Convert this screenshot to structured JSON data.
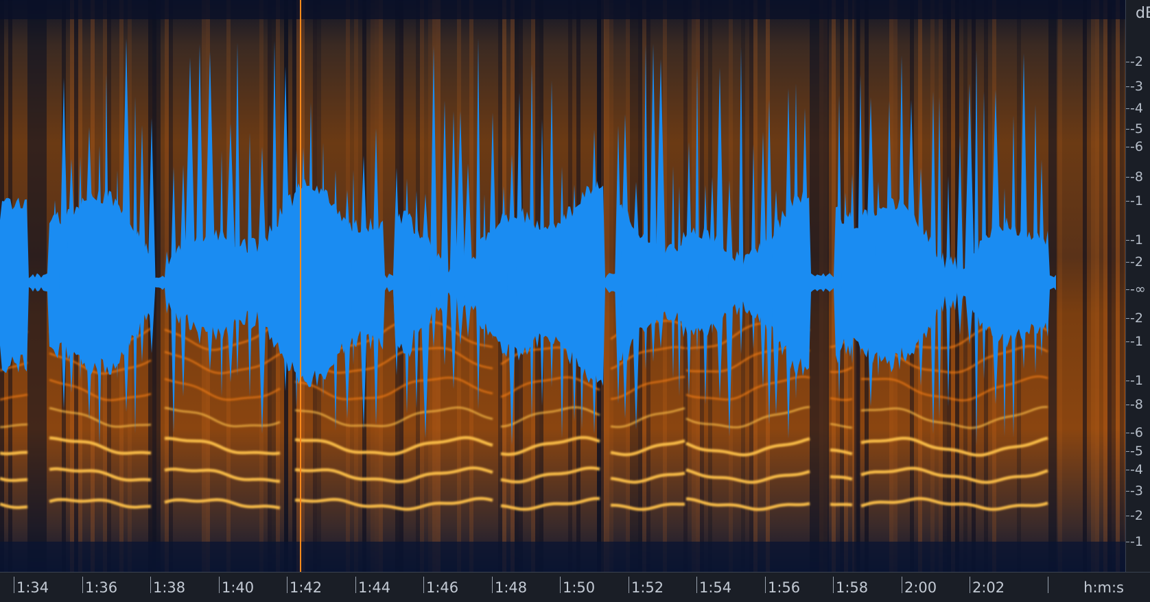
{
  "view": {
    "type": "spectrogram-waveform-editor",
    "spectrogram_palette": [
      "#0c1224",
      "#3a2a22",
      "#a24b0c",
      "#f07a10",
      "#ffc04a"
    ],
    "waveform_color": "#1a8cf2",
    "playhead_color": "#ff8a1a"
  },
  "amplitude_ruler": {
    "unit": "dB",
    "labels": [
      "-2",
      "-3",
      "-4",
      "-5",
      "-6",
      "-8",
      "-1",
      "-1",
      "-2",
      "-∞",
      "-2",
      "-1",
      "-1",
      "-8",
      "-6",
      "-5",
      "-4",
      "-3",
      "-2",
      "-1"
    ]
  },
  "time_ruler": {
    "unit": "h:m:s",
    "labels": [
      "1:34",
      "1:36",
      "1:38",
      "1:40",
      "1:42",
      "1:44",
      "1:46",
      "1:48",
      "1:50",
      "1:52",
      "1:54",
      "1:56",
      "1:58",
      "2:00",
      "2:02"
    ]
  }
}
